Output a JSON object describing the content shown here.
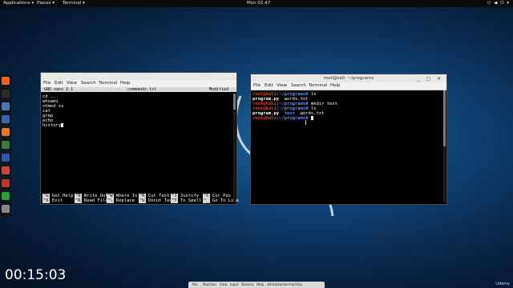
{
  "topbar": {
    "applications": "Applications ▾",
    "places": "Places ▾",
    "terminal": "Terminal ▾",
    "clock": "Mon 02:47",
    "status": "⚇ ◀ ⏻ ▾"
  },
  "dock": {
    "icons": [
      "firefox-icon",
      "terminal-icon",
      "files-icon",
      "metasploit-icon",
      "burp-icon",
      "armitage-icon",
      "maltego-icon",
      "beef-icon",
      "faraday-icon",
      "leafpad-icon",
      "apps-grid-icon"
    ],
    "colors": [
      "#e8681d",
      "#2b2b2b",
      "#4a78b5",
      "#3a63b0",
      "#e07a2a",
      "#3c7b3c",
      "#3355aa",
      "#c44",
      "#b33",
      "#2e9e3a",
      "#888"
    ]
  },
  "left_window": {
    "menu": [
      "File",
      "Edit",
      "View",
      "Search",
      "Terminal",
      "Help"
    ],
    "nano_version": "GNU nano 2.1",
    "filename": "commands.txt",
    "modified": "Modified",
    "lines": [
      "cd ..",
      "whoami",
      "chmod +x",
      "cat",
      "grep",
      "echo",
      "history"
    ],
    "shortcuts_row1": [
      {
        "key": "^G",
        "label": "Get Help"
      },
      {
        "key": "^O",
        "label": "Write Out"
      },
      {
        "key": "^W",
        "label": "Where Is"
      },
      {
        "key": "^K",
        "label": "Cut Text"
      },
      {
        "key": "^J",
        "label": "Justify"
      },
      {
        "key": "^C",
        "label": "Cur Pos"
      }
    ],
    "shortcuts_row2": [
      {
        "key": "^X",
        "label": "Exit"
      },
      {
        "key": "^R",
        "label": "Read File"
      },
      {
        "key": "^\\",
        "label": "Replace"
      },
      {
        "key": "^U",
        "label": "Uncut Text"
      },
      {
        "key": "^T",
        "label": "To Spell"
      },
      {
        "key": "^_",
        "label": "Go To Line"
      }
    ]
  },
  "right_window": {
    "title": "root@kali: ~/programs",
    "menu": [
      "File",
      "Edit",
      "View",
      "Search",
      "Terminal",
      "Help"
    ],
    "prompt_user": "root@kali",
    "prompt_path": ":~/programs#",
    "lines": [
      {
        "cmd": " ls"
      },
      {
        "output": "program.py  words.txt"
      },
      {
        "cmd": " mkdir test"
      },
      {
        "cmd": " ls"
      },
      {
        "output": "program.py  test  words.txt"
      },
      {
        "cmd": " "
      }
    ],
    "output_bold": "program.py",
    "output_dir": "test"
  },
  "timer": "00:15:03",
  "taskbar": {
    "items": [
      "file",
      "Machine",
      "View",
      "Input",
      "Devices",
      "Help",
      "ethicalhackermachine"
    ]
  },
  "watermark": "Udemy"
}
